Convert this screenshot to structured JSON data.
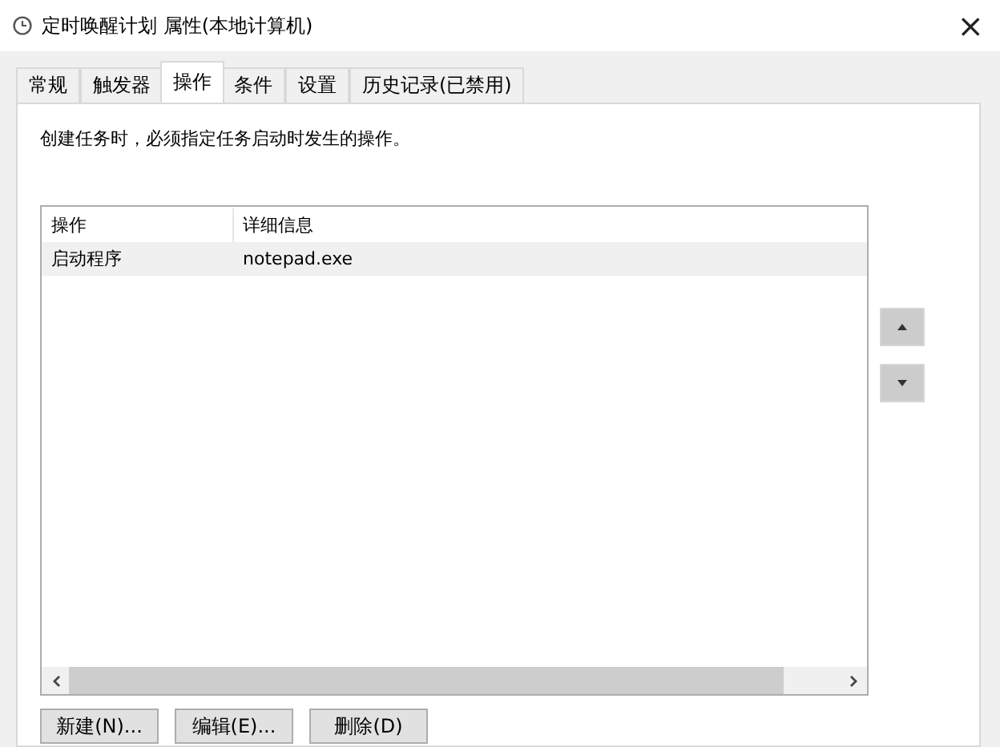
{
  "window": {
    "title": "定时唤醒计划 属性(本地计算机)",
    "close": "×"
  },
  "tabs": [
    {
      "label": "常规",
      "selected": false
    },
    {
      "label": "触发器",
      "selected": false
    },
    {
      "label": "操作",
      "selected": true
    },
    {
      "label": "条件",
      "selected": false
    },
    {
      "label": "设置",
      "selected": false
    },
    {
      "label": "历史记录(已禁用)",
      "selected": false
    }
  ],
  "description": "创建任务时，必须指定任务启动时发生的操作。",
  "table": {
    "columns": [
      "操作",
      "详细信息"
    ],
    "rows": [
      {
        "cells": [
          "启动程序",
          "notepad.exe"
        ],
        "selected": true
      }
    ]
  },
  "buttons": [
    "新建(N)...",
    "编辑(E)...",
    "删除(D)"
  ]
}
